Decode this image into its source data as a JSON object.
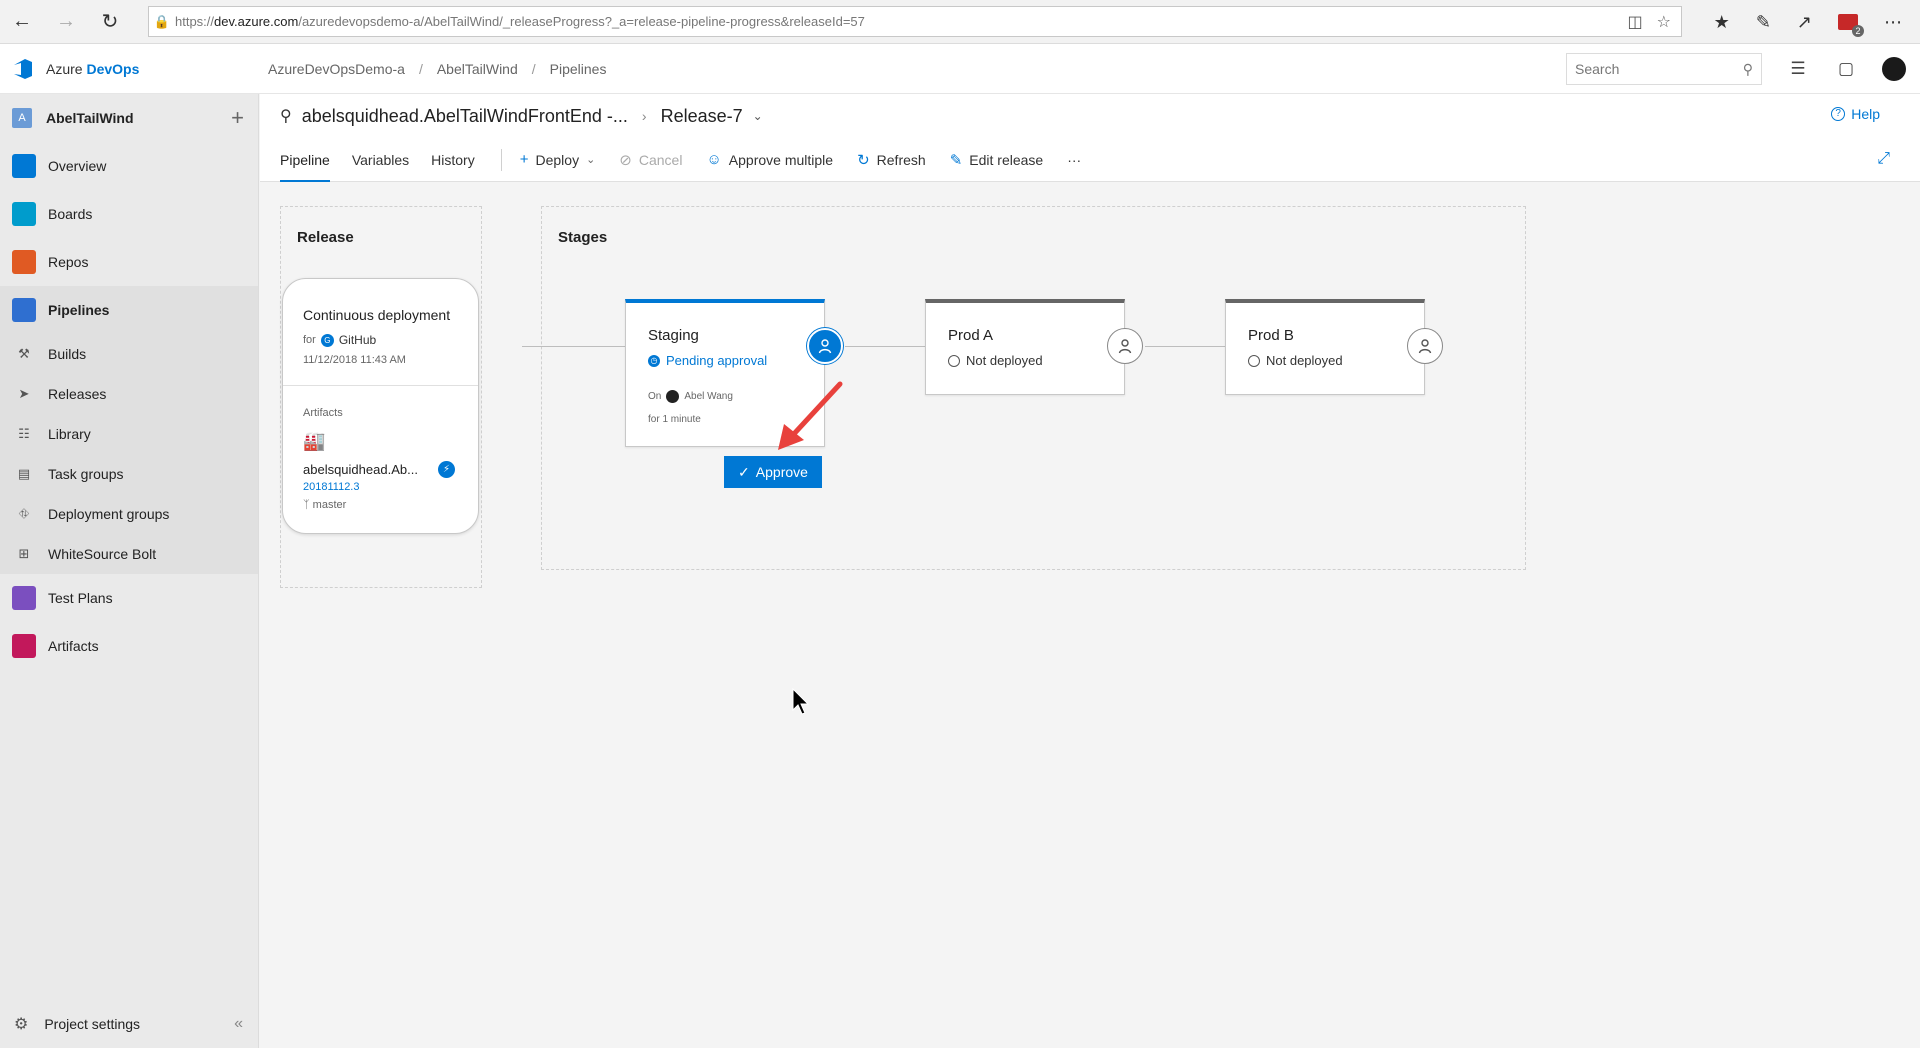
{
  "browser": {
    "url_prefix": "https://",
    "url_host": "dev.azure.com",
    "url_path": "/azuredevopsdemo-a/AbelTailWind/_releaseProgress?_a=release-pipeline-progress&releaseId=57",
    "ext_badge": "2"
  },
  "header": {
    "brand_prefix": "Azure ",
    "brand_bold": "DevOps",
    "breadcrumb": [
      "AzureDevOpsDemo-a",
      "AbelTailWind",
      "Pipelines"
    ],
    "search_placeholder": "Search"
  },
  "sidebar": {
    "project_initial": "A",
    "project_name": "AbelTailWind",
    "items": [
      {
        "label": "Overview",
        "color": "#0078d4"
      },
      {
        "label": "Boards",
        "color": "#009ccc"
      },
      {
        "label": "Repos",
        "color": "#e05a23"
      },
      {
        "label": "Pipelines",
        "color": "#2f6fd0"
      },
      {
        "label": "Test Plans",
        "color": "#7b4fbf"
      },
      {
        "label": "Artifacts",
        "color": "#c2185b"
      }
    ],
    "pipeline_sub": [
      "Builds",
      "Releases",
      "Library",
      "Task groups",
      "Deployment groups",
      "WhiteSource Bolt"
    ],
    "settings_label": "Project settings"
  },
  "release": {
    "definition": "abelsquidhead.AbelTailWindFrontEnd -...",
    "name": "Release-7",
    "help": "Help"
  },
  "toolbar": {
    "tabs": [
      "Pipeline",
      "Variables",
      "History"
    ],
    "deploy": "Deploy",
    "cancel": "Cancel",
    "approve_multiple": "Approve multiple",
    "refresh": "Refresh",
    "edit_release": "Edit release",
    "more": "···"
  },
  "canvas": {
    "release_title": "Release",
    "stages_title": "Stages",
    "trigger": {
      "title": "Continuous deployment",
      "for_label": "for",
      "source": "GitHub",
      "datetime": "11/12/2018 11:43 AM"
    },
    "artifact": {
      "section_label": "Artifacts",
      "name": "abelsquidhead.Ab...",
      "version": "20181112.3",
      "branch": "master"
    },
    "stages": [
      {
        "name": "Staging",
        "status": "Pending approval",
        "on_label": "On",
        "approver": "Abel Wang",
        "duration": "for 1 minute"
      },
      {
        "name": "Prod A",
        "status": "Not deployed"
      },
      {
        "name": "Prod B",
        "status": "Not deployed"
      }
    ],
    "approve_button": "Approve"
  },
  "colors": {
    "accent": "#0078d4",
    "annotation_arrow": "#e8413c"
  }
}
